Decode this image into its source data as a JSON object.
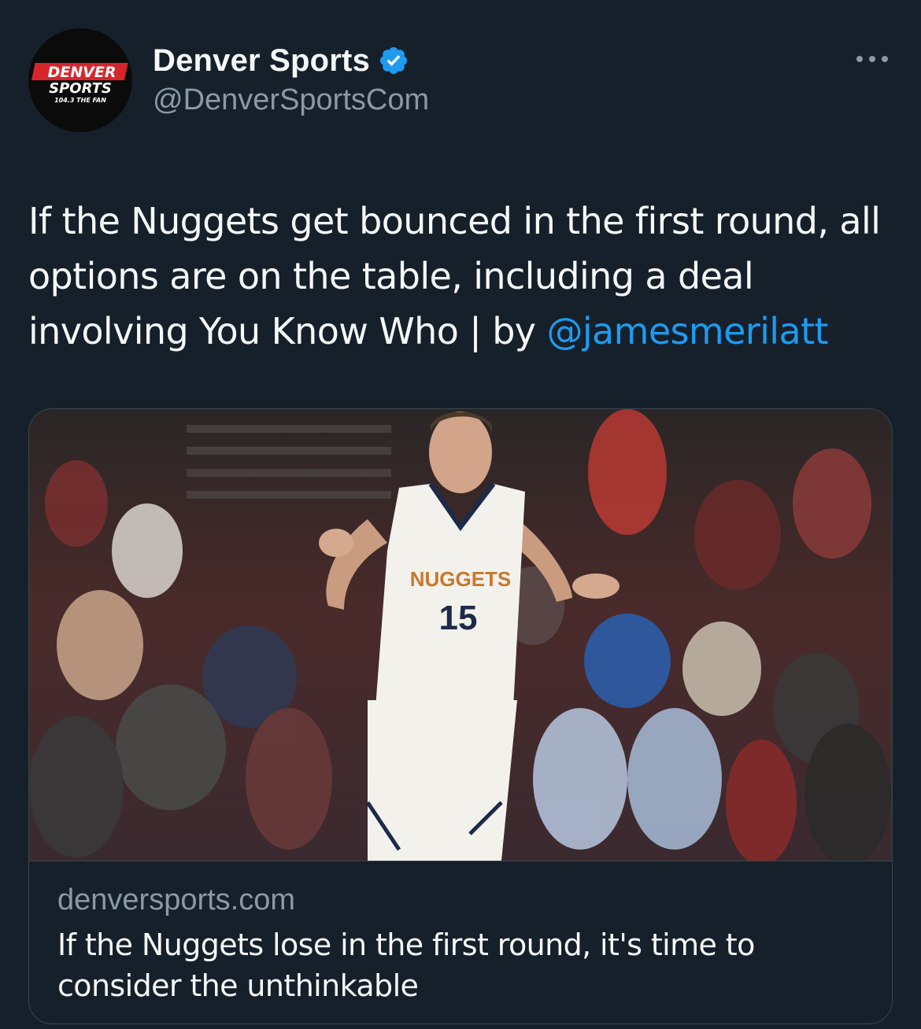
{
  "tweet": {
    "author": {
      "display_name": "Denver Sports",
      "handle": "@DenverSportsCom",
      "verified": true,
      "avatar_lines": [
        "DENVER",
        "SPORTS",
        "104.3 THE FAN"
      ]
    },
    "text": "If the Nuggets get bounced in the first round, all options are on the table, including a deal involving You Know Who | by ",
    "mention": "@jamesmerilatt",
    "more_icon": "more-horizontal-icon"
  },
  "card": {
    "image_alt": "Nuggets player number 15 shrugging on court",
    "jersey_text": "NUGGETS",
    "jersey_number": "15",
    "domain": "denversports.com",
    "title": "If the Nuggets lose in the first round, it's time to consider the unthinkable"
  },
  "colors": {
    "background": "#15202b",
    "text": "#f7f9f9",
    "secondary": "#8b98a5",
    "accent": "#1d9bf0",
    "border": "#38444d",
    "avatar_red": "#d7262b"
  }
}
